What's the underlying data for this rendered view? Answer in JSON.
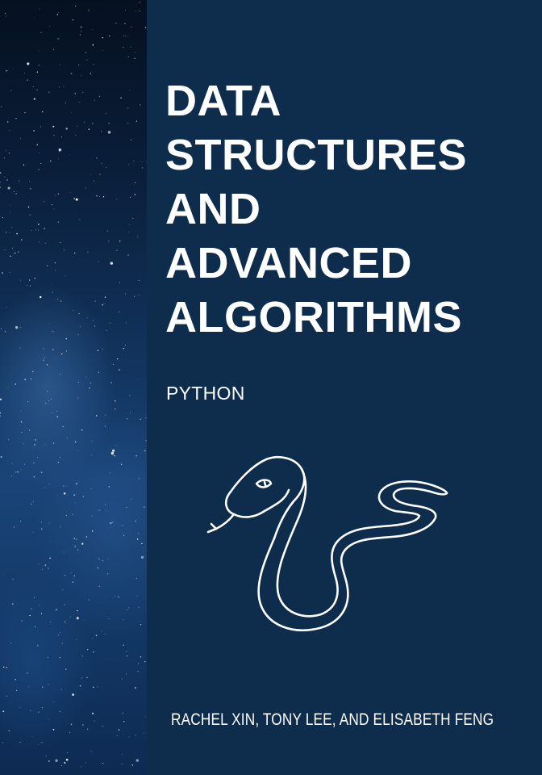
{
  "book": {
    "title_lines": [
      "DATA",
      "STRUCTURES",
      "AND",
      "ADVANCED",
      "ALGORITHMS"
    ],
    "subtitle": "PYTHON",
    "authors": "RACHEL XIN, TONY LEE, AND ELISABETH FENG"
  },
  "colors": {
    "panel_background": "#0e2c4c",
    "text": "#ffffff",
    "illustration_stroke": "#ffffff"
  },
  "icons": {
    "illustration": "snake-icon"
  }
}
